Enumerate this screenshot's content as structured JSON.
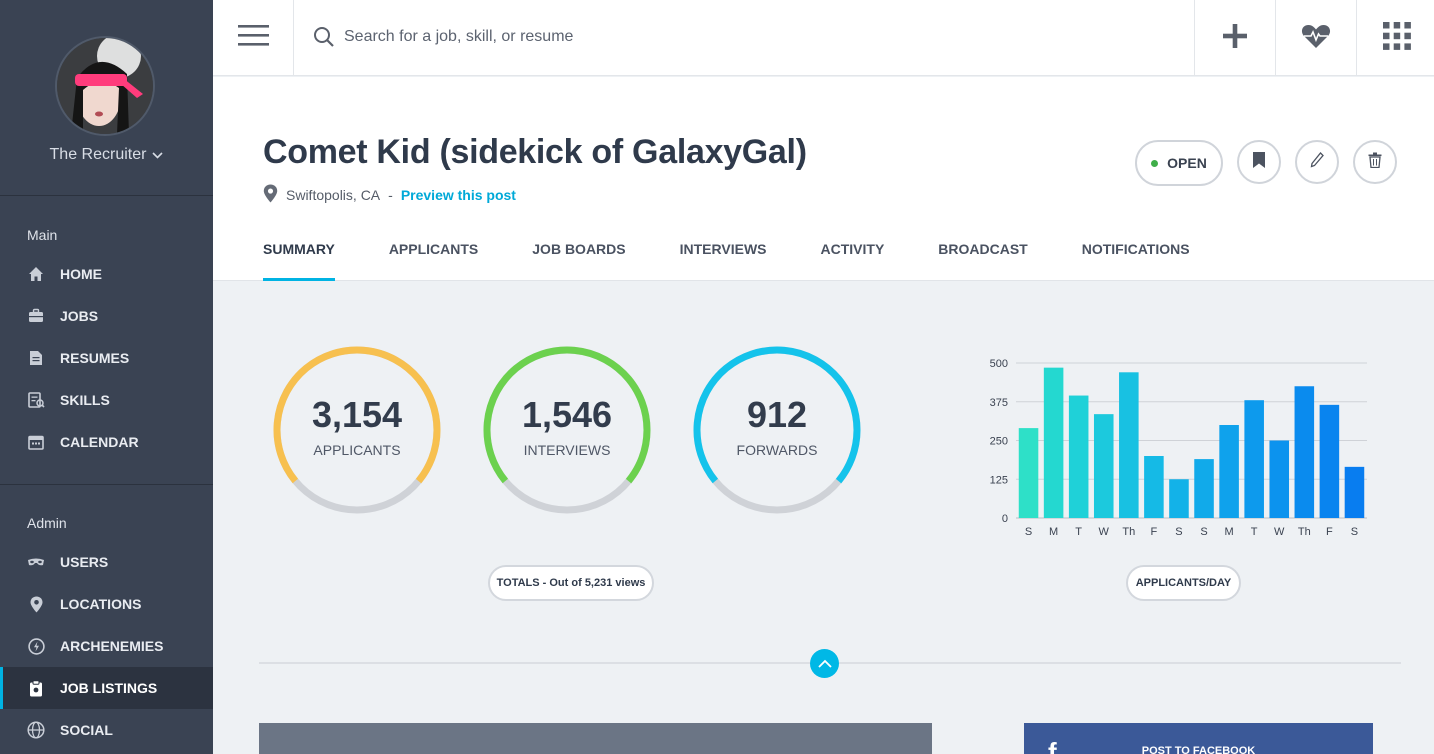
{
  "user": {
    "name": "The Recruiter"
  },
  "sidebar": {
    "main_label": "Main",
    "main_items": [
      {
        "label": "HOME",
        "icon": "home-icon"
      },
      {
        "label": "JOBS",
        "icon": "briefcase-icon"
      },
      {
        "label": "RESUMES",
        "icon": "document-icon"
      },
      {
        "label": "SKILLS",
        "icon": "skills-icon"
      },
      {
        "label": "CALENDAR",
        "icon": "calendar-icon"
      }
    ],
    "admin_label": "Admin",
    "admin_items": [
      {
        "label": "USERS",
        "icon": "mask-icon"
      },
      {
        "label": "LOCATIONS",
        "icon": "map-pin-icon"
      },
      {
        "label": "ARCHENEMIES",
        "icon": "bolt-icon"
      },
      {
        "label": "JOB LISTINGS",
        "icon": "clipboard-icon",
        "active": true
      },
      {
        "label": "SOCIAL",
        "icon": "globe-icon"
      }
    ]
  },
  "topbar": {
    "search_placeholder": "Search for a job, skill, or resume",
    "icons": [
      "menu-icon",
      "search-icon",
      "plus-icon",
      "heart-pulse-icon",
      "grid-icon"
    ]
  },
  "job": {
    "title": "Comet Kid (sidekick of GalaxyGal)",
    "location": "Swiftopolis, CA",
    "separator": "-",
    "preview_link": "Preview this post",
    "status": "OPEN",
    "status_color": "#3fae49"
  },
  "tabs": [
    "SUMMARY",
    "APPLICANTS",
    "JOB BOARDS",
    "INTERVIEWS",
    "ACTIVITY",
    "BROADCAST",
    "NOTIFICATIONS"
  ],
  "active_tab": "SUMMARY",
  "stats": [
    {
      "value": "3,154",
      "label": "APPLICANTS",
      "color": "#f7c04f",
      "fraction": 0.72
    },
    {
      "value": "1,546",
      "label": "INTERVIEWS",
      "color": "#6cd14e",
      "fraction": 0.72
    },
    {
      "value": "912",
      "label": "FORWARDS",
      "color": "#14c3eb",
      "fraction": 0.72
    }
  ],
  "totals_label": "TOTALS - Out of 5,231 views",
  "chart_label": "APPLICANTS/DAY",
  "chart_data": {
    "type": "bar",
    "categories": [
      "S",
      "M",
      "T",
      "W",
      "Th",
      "F",
      "S",
      "S",
      "M",
      "T",
      "W",
      "Th",
      "F",
      "S"
    ],
    "values": [
      290,
      485,
      395,
      335,
      470,
      200,
      125,
      190,
      300,
      380,
      250,
      425,
      365,
      165
    ],
    "yticks": [
      0,
      125,
      250,
      375,
      500
    ],
    "ylim": [
      0,
      500
    ],
    "grid": true,
    "colors": [
      "#2ee0c8",
      "#24d8d0",
      "#1fd1d8",
      "#1cc9dd",
      "#18c1e2",
      "#15bae6",
      "#13b2e8",
      "#11aaea",
      "#0fa2ec",
      "#0d9aed",
      "#0c93ee",
      "#0a8bee",
      "#0984ef",
      "#087df0"
    ]
  },
  "facebook": {
    "label": "POST TO FACEBOOK"
  }
}
